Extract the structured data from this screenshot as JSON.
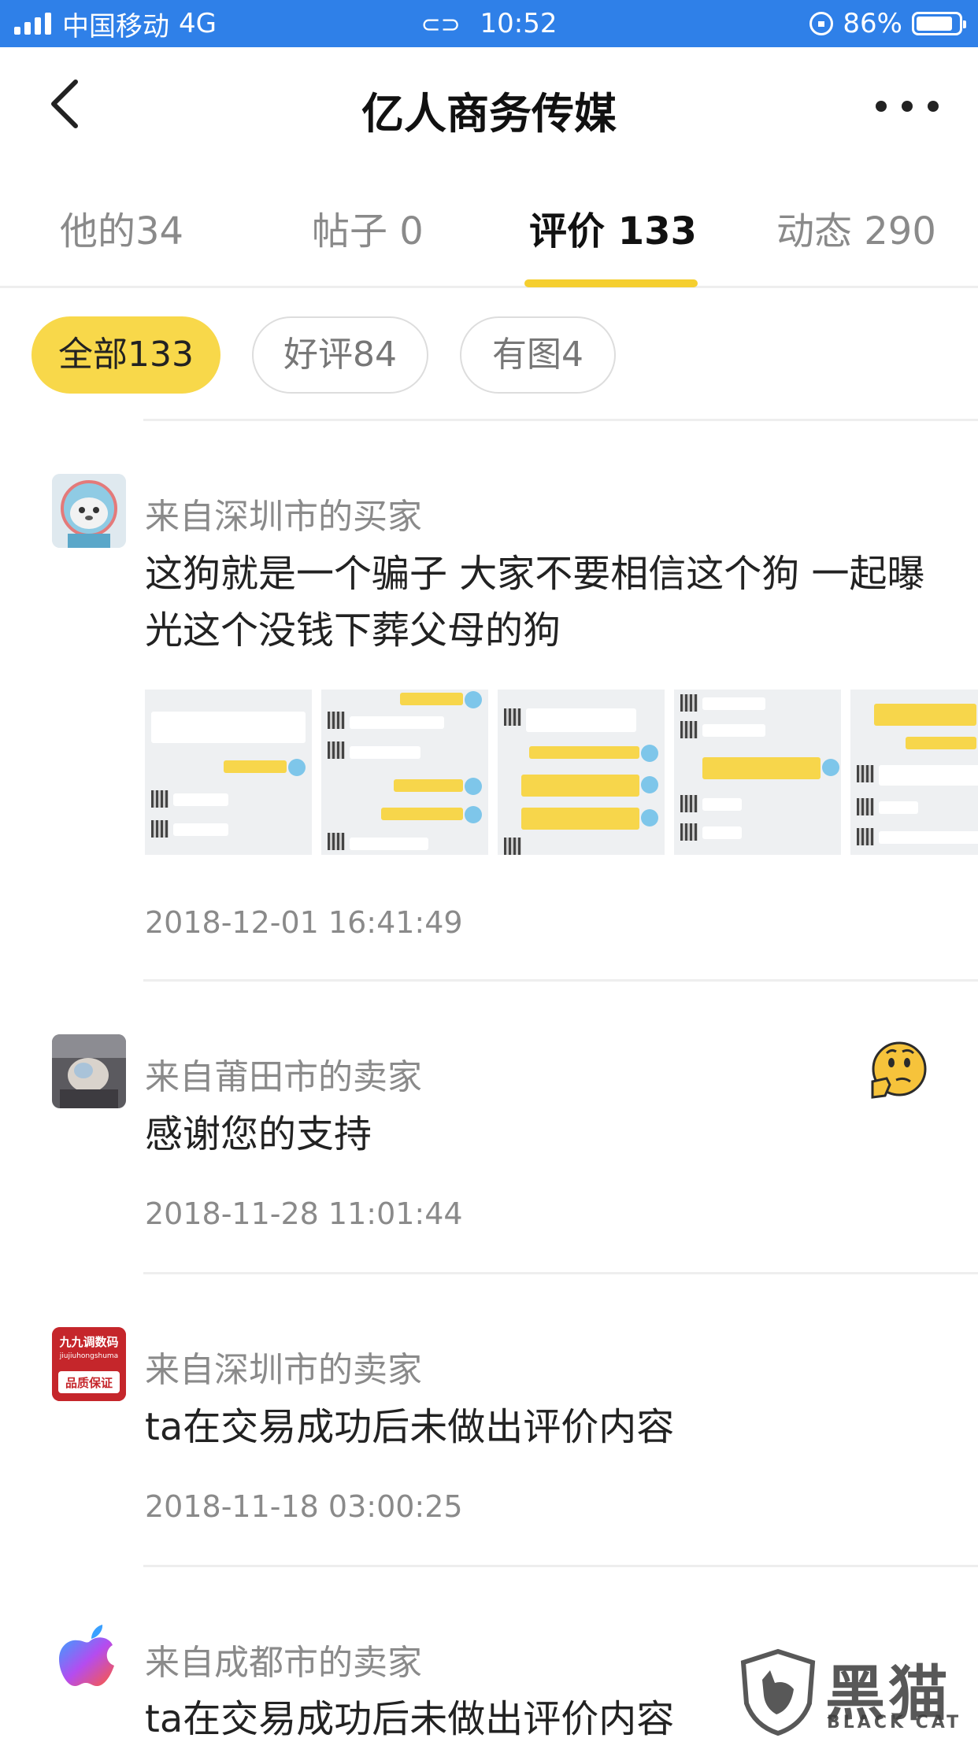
{
  "status_bar": {
    "carrier": "中国移动",
    "network": "4G",
    "time": "10:52",
    "battery": "86%",
    "battery_level": 0.86
  },
  "nav": {
    "title": "亿人商务传媒",
    "back_icon": "chevron-left-icon",
    "more_icon": "more-dots-icon"
  },
  "tabs": [
    {
      "label": "他的34"
    },
    {
      "label": "帖子 0"
    },
    {
      "label": "评价 133",
      "active": true
    },
    {
      "label": "动态 290"
    }
  ],
  "filters": [
    {
      "label": "全部133",
      "active": true
    },
    {
      "label": "好评84"
    },
    {
      "label": "有图4"
    }
  ],
  "reviews": [
    {
      "author": "来自深圳市的买家",
      "text": "这狗就是一个骗子 大家不要相信这个狗 一起曝光这个没钱下葬父母的狗",
      "time": "2018-12-01 16:41:49",
      "thumbnail_count": 5
    },
    {
      "author": "来自莆田市的卖家",
      "text": "感谢您的支持",
      "time": "2018-11-28 11:01:44",
      "emoji": "thinking-face-icon"
    },
    {
      "author": "来自深圳市的卖家",
      "text": "ta在交易成功后未做出评价内容",
      "time": "2018-11-18 03:00:25",
      "avatar_text": [
        "九九调数码",
        "jiujiuhongshuma",
        "品质保证"
      ]
    },
    {
      "author": "来自成都市的卖家",
      "text": "ta在交易成功后未做出评价内容"
    }
  ],
  "watermark": {
    "text": "黑猫",
    "subtext": "BLACK CAT"
  },
  "colors": {
    "status_bar": "#2f80e8",
    "accent": "#f8d84a",
    "indicator": "#f5cf2f"
  }
}
